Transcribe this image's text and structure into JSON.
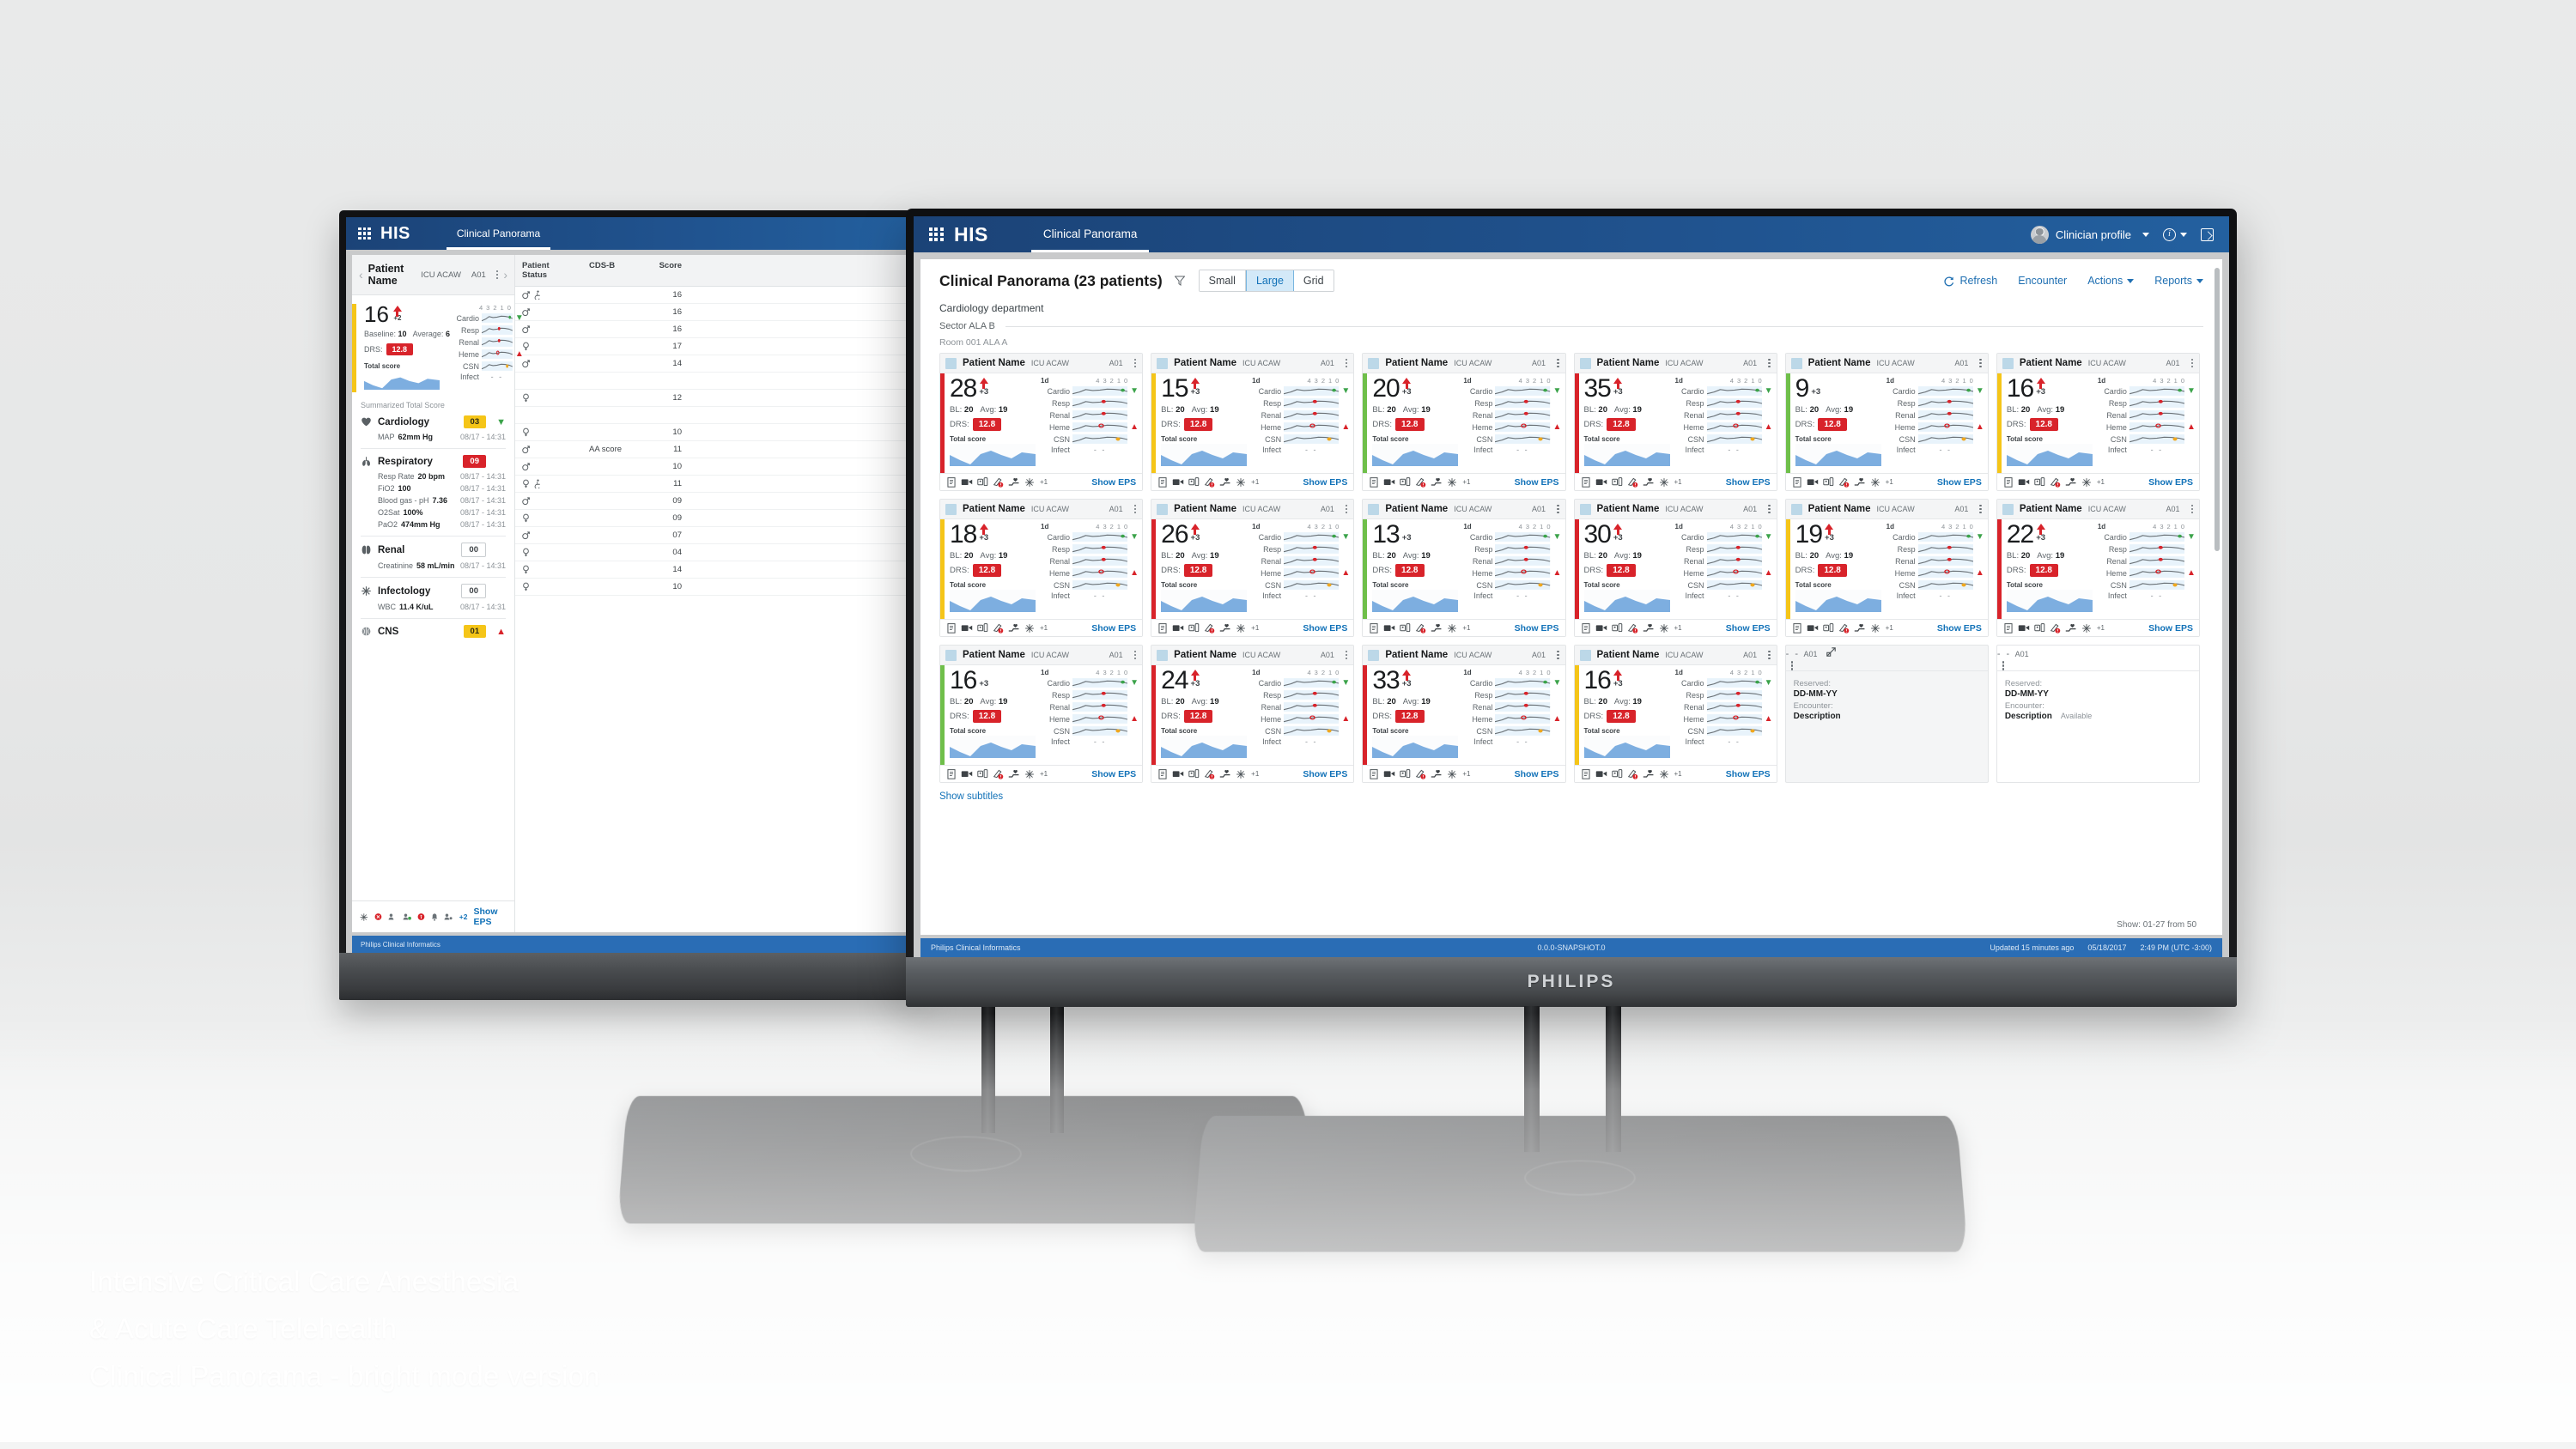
{
  "caption": {
    "line1": "Intensive Critical Care Anesthesia",
    "line2": "& Acute Care Telehealth",
    "line3": "Clinical Panorama - bright mode version"
  },
  "monitor_brand": "PHILIPS",
  "front": {
    "appbar": {
      "brand": "HIS",
      "tab": "Clinical Panorama",
      "profile": "Clinician profile",
      "grid_icon": "app-grid-icon",
      "info_icon": "info-icon",
      "expand_icon": "expand-icon"
    },
    "toolbar": {
      "title": "Clinical Panorama (23 patients)",
      "filter_icon": "filter-icon",
      "views": [
        "Small",
        "Large",
        "Grid"
      ],
      "active_view": "Large",
      "refresh": "Refresh",
      "refresh_icon": "refresh-icon",
      "encounter": "Encounter",
      "actions": "Actions",
      "reports": "Reports"
    },
    "department": "Cardiology department",
    "sector": "Sector ALA B",
    "room": "Room 001 ALA A",
    "card_labels": {
      "name": "Patient Name",
      "unit": "ICU ACAW",
      "bed": "A01",
      "day": "1d",
      "ticks": [
        "4",
        "3",
        "2",
        "1",
        "0"
      ],
      "organs": [
        "Cardio",
        "Resp",
        "Renal",
        "Heme",
        "CSN",
        "Infect"
      ],
      "bl": "BL:",
      "avg": "Avg:",
      "drs": "DRS:",
      "total_score": "Total score",
      "infect_value": "- -",
      "plus_more": "+1",
      "show_eps": "Show EPS",
      "bl_value": "20",
      "avg_value": "19",
      "drs_value": "12.8",
      "delta": "+3"
    },
    "reserved_labels": {
      "dash": "- -",
      "bed": "A01",
      "reserved": "Reserved:",
      "reserved_value": "DD-MM-YY",
      "encounter": "Encounter:",
      "encounter_value": "Description",
      "available": "Available"
    },
    "cards": [
      {
        "score": "28",
        "sev": "#d8232a",
        "trend": "up"
      },
      {
        "score": "15",
        "sev": "#f5c518",
        "trend": "up"
      },
      {
        "score": "20",
        "sev": "#6fbf4a",
        "trend": "up"
      },
      {
        "score": "35",
        "sev": "#d8232a",
        "trend": "up"
      },
      {
        "score": "9",
        "sev": "#6fbf4a",
        "trend": "none"
      },
      {
        "score": "16",
        "sev": "#f5c518",
        "trend": "up"
      },
      {
        "score": "18",
        "sev": "#f5c518",
        "trend": "up"
      },
      {
        "score": "26",
        "sev": "#d8232a",
        "trend": "up"
      },
      {
        "score": "13",
        "sev": "#6fbf4a",
        "trend": "none"
      },
      {
        "score": "30",
        "sev": "#d8232a",
        "trend": "up"
      },
      {
        "score": "19",
        "sev": "#f5c518",
        "trend": "up"
      },
      {
        "score": "22",
        "sev": "#d8232a",
        "trend": "up"
      },
      {
        "score": "16",
        "sev": "#6fbf4a",
        "trend": "none"
      },
      {
        "score": "24",
        "sev": "#d8232a",
        "trend": "up"
      },
      {
        "score": "33",
        "sev": "#d8232a",
        "trend": "up"
      },
      {
        "score": "16",
        "sev": "#f5c518",
        "trend": "up"
      }
    ],
    "subtitles_link": "Show subtitles",
    "show_count": "Show: 01-27 from 50",
    "statusbar": {
      "left": "Philips Clinical Informatics",
      "mid": "0.0.0-SNAPSHOT.0",
      "updated": "Updated 15 minutes ago",
      "date": "05/18/2017",
      "time": "2:49 PM (UTC -3:00)"
    }
  },
  "back": {
    "appbar": {
      "brand": "HIS",
      "tab": "Clinical Panorama"
    },
    "patient": {
      "name": "Patient Name",
      "unit": "ICU ACAW",
      "bed": "A01",
      "score": "16",
      "delta": "+2",
      "baseline_label": "Baseline:",
      "baseline": "10",
      "average_label": "Average:",
      "average": "6",
      "drs_label": "DRS:",
      "drs": "12.8",
      "total_score": "Total score",
      "ticks": [
        "4",
        "3",
        "2",
        "1",
        "0"
      ],
      "organs": [
        "Cardio",
        "Resp",
        "Renal",
        "Heme",
        "CSN",
        "Infect"
      ],
      "infect_value": "- -"
    },
    "summary_title": "Summarized Total Score",
    "summary": [
      {
        "icon": "heart-icon",
        "name": "Cardiology",
        "badge": "03",
        "badge_type": "y",
        "arrow": "down",
        "rows": [
          {
            "k": "MAP",
            "v": "62mm Hg",
            "t": "08/17 - 14:31"
          }
        ]
      },
      {
        "icon": "lungs-icon",
        "name": "Respiratory",
        "badge": "09",
        "badge_type": "r",
        "arrow": "none",
        "rows": [
          {
            "k": "Resp Rate",
            "v": "20 bpm",
            "t": "08/17 - 14:31"
          },
          {
            "k": "FiO2",
            "v": "100",
            "t": "08/17 - 14:31"
          },
          {
            "k": "Blood gas - pH",
            "v": "7.36",
            "t": "08/17 - 14:31"
          },
          {
            "k": "O2Sat",
            "v": "100%",
            "t": "08/17 - 14:31"
          },
          {
            "k": "PaO2",
            "v": "474mm Hg",
            "t": "08/17 - 14:31"
          }
        ]
      },
      {
        "icon": "kidney-icon",
        "name": "Renal",
        "badge": "00",
        "badge_type": "o",
        "arrow": "none",
        "rows": [
          {
            "k": "Creatinine",
            "v": "58 mL/min",
            "t": "08/17 - 14:31"
          }
        ]
      },
      {
        "icon": "virus-icon",
        "name": "Infectology",
        "badge": "00",
        "badge_type": "o",
        "arrow": "none",
        "rows": [
          {
            "k": "WBC",
            "v": "11.4 K/uL",
            "t": "08/17 - 14:31"
          }
        ]
      },
      {
        "icon": "brain-icon",
        "name": "CNS",
        "badge": "01",
        "badge_type": "y",
        "arrow": "up",
        "rows": []
      }
    ],
    "footer": {
      "plus": "+2",
      "show_eps": "Show EPS"
    },
    "table": {
      "headers": [
        "Patient Status",
        "CDS-B",
        "Score"
      ],
      "rows": [
        {
          "sex": "male",
          "wheelchair": true,
          "cds": "",
          "score": "16"
        },
        {
          "sex": "male",
          "wheelchair": false,
          "cds": "",
          "score": "16"
        },
        {
          "sex": "male",
          "wheelchair": false,
          "cds": "",
          "score": "16"
        },
        {
          "sex": "female",
          "wheelchair": false,
          "cds": "",
          "score": "17"
        },
        {
          "sex": "male",
          "wheelchair": false,
          "cds": "",
          "score": "14"
        },
        {
          "sex": "",
          "wheelchair": false,
          "cds": "",
          "score": ""
        },
        {
          "sex": "female",
          "wheelchair": false,
          "cds": "",
          "score": "12"
        },
        {
          "sex": "",
          "wheelchair": false,
          "cds": "",
          "score": ""
        },
        {
          "sex": "female",
          "wheelchair": false,
          "cds": "",
          "score": "10"
        },
        {
          "sex": "male",
          "wheelchair": false,
          "cds": "AA score",
          "score": "11"
        },
        {
          "sex": "male",
          "wheelchair": false,
          "cds": "",
          "score": "10"
        },
        {
          "sex": "female",
          "wheelchair": true,
          "cds": "",
          "score": "11"
        },
        {
          "sex": "male",
          "wheelchair": false,
          "cds": "",
          "score": "09"
        },
        {
          "sex": "female",
          "wheelchair": false,
          "cds": "",
          "score": "09"
        },
        {
          "sex": "male",
          "wheelchair": false,
          "cds": "",
          "score": "07"
        },
        {
          "sex": "female",
          "wheelchair": false,
          "cds": "",
          "score": "04"
        },
        {
          "sex": "female",
          "wheelchair": false,
          "cds": "",
          "score": "14"
        },
        {
          "sex": "female",
          "wheelchair": false,
          "cds": "",
          "score": "10"
        }
      ]
    },
    "statusbar": {
      "left": "Philips Clinical Informatics"
    }
  }
}
